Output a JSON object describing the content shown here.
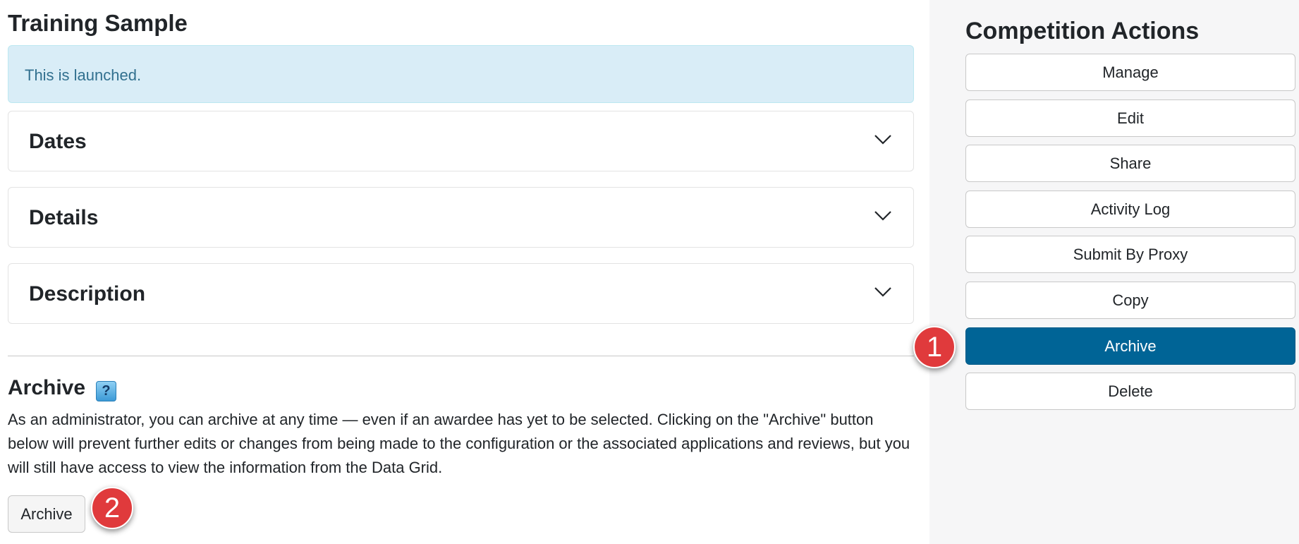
{
  "page_title": "Training Sample",
  "alert": {
    "text": "This is launched."
  },
  "panels": [
    {
      "title": "Dates",
      "icon": "chevron-down-icon"
    },
    {
      "title": "Details",
      "icon": "chevron-down-icon"
    },
    {
      "title": "Description",
      "icon": "chevron-down-icon"
    }
  ],
  "archive_section": {
    "title": "Archive",
    "help_icon": "question-icon",
    "help_glyph": "?",
    "description": "As an administrator, you can archive at any time — even if an awardee has yet to be selected. Clicking on the \"Archive\" button below will prevent further edits or changes from being made to the configuration or the associated applications and reviews, but you will still have access to view the information from the Data Grid.",
    "button_label": "Archive"
  },
  "sidebar": {
    "title": "Competition Actions",
    "actions": [
      {
        "label": "Manage",
        "active": false
      },
      {
        "label": "Edit",
        "active": false
      },
      {
        "label": "Share",
        "active": false
      },
      {
        "label": "Activity Log",
        "active": false
      },
      {
        "label": "Submit By Proxy",
        "active": false
      },
      {
        "label": "Copy",
        "active": false
      },
      {
        "label": "Archive",
        "active": true
      },
      {
        "label": "Delete",
        "active": false
      }
    ]
  },
  "step_badges": [
    "1",
    "2"
  ],
  "colors": {
    "active_button": "#006496",
    "alert_bg": "#d9edf7",
    "alert_text": "#31708f",
    "badge": "#e03a3c",
    "sidebar_bg": "#f6f6f7"
  }
}
